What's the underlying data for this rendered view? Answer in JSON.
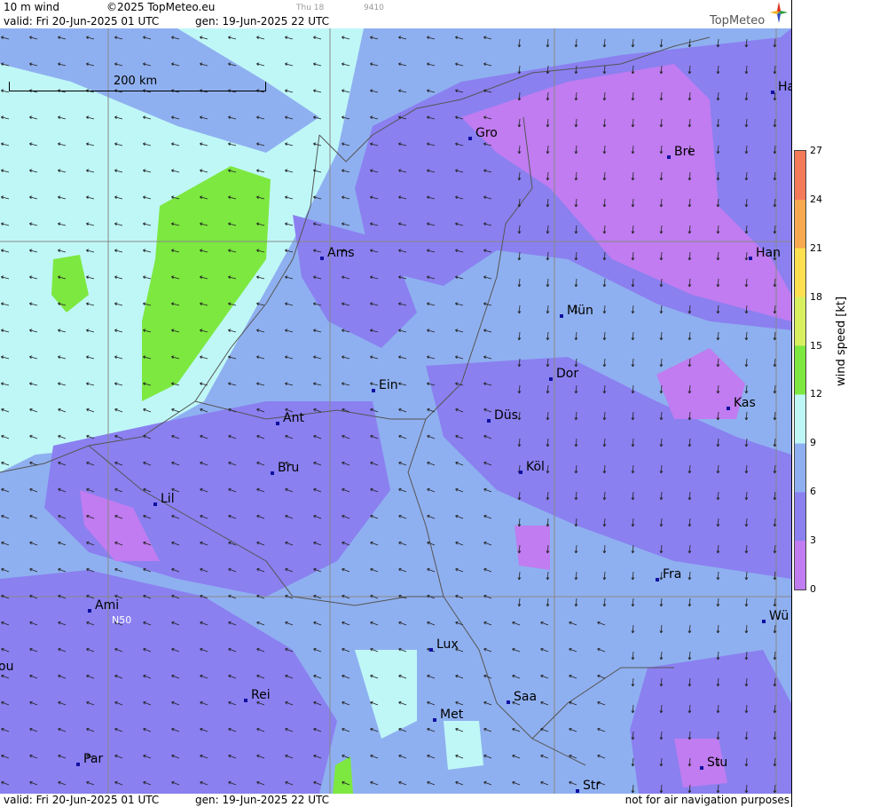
{
  "header": {
    "product": "10 m wind",
    "copyright": "©2025 TopMeteo.eu",
    "day_label": "Thu 18",
    "code": "9410",
    "valid": "valid:  Fri  20-Jun-2025  01 UTC",
    "gen": "gen: 19-Jun-2025 22 UTC",
    "logo": "TopMeteo"
  },
  "footer": {
    "valid": "valid:  Fri  20-Jun-2025  01 UTC",
    "gen": "gen: 19-Jun-2025 22 UTC",
    "disclaimer": "not for air navigation purposes"
  },
  "scale_bar": {
    "label": "200 km"
  },
  "grid_label": "N50",
  "legend": {
    "title": "wind speed [kt]",
    "ticks": [
      "27",
      "24",
      "21",
      "18",
      "15",
      "12",
      "9",
      "6",
      "3",
      "0"
    ],
    "colors": [
      "#f47a5a",
      "#f7a850",
      "#fde050",
      "#d8f060",
      "#7de840",
      "#bff7f7",
      "#8fb0f0",
      "#8a80f0",
      "#c07cf0"
    ]
  },
  "cities": [
    {
      "name": "Gro"
    },
    {
      "name": "Bre"
    },
    {
      "name": "Ha"
    },
    {
      "name": "Ams"
    },
    {
      "name": "Han"
    },
    {
      "name": "Mün"
    },
    {
      "name": "Dor"
    },
    {
      "name": "Ein"
    },
    {
      "name": "Kas"
    },
    {
      "name": "Ant"
    },
    {
      "name": "Düs"
    },
    {
      "name": "Bru"
    },
    {
      "name": "Köl"
    },
    {
      "name": "Lil"
    },
    {
      "name": "Fra"
    },
    {
      "name": "Ami"
    },
    {
      "name": "Wü"
    },
    {
      "name": "Lux"
    },
    {
      "name": "ou"
    },
    {
      "name": "Rei"
    },
    {
      "name": "Saa"
    },
    {
      "name": "Met"
    },
    {
      "name": "Par"
    },
    {
      "name": "Stu"
    },
    {
      "name": "Str"
    }
  ]
}
